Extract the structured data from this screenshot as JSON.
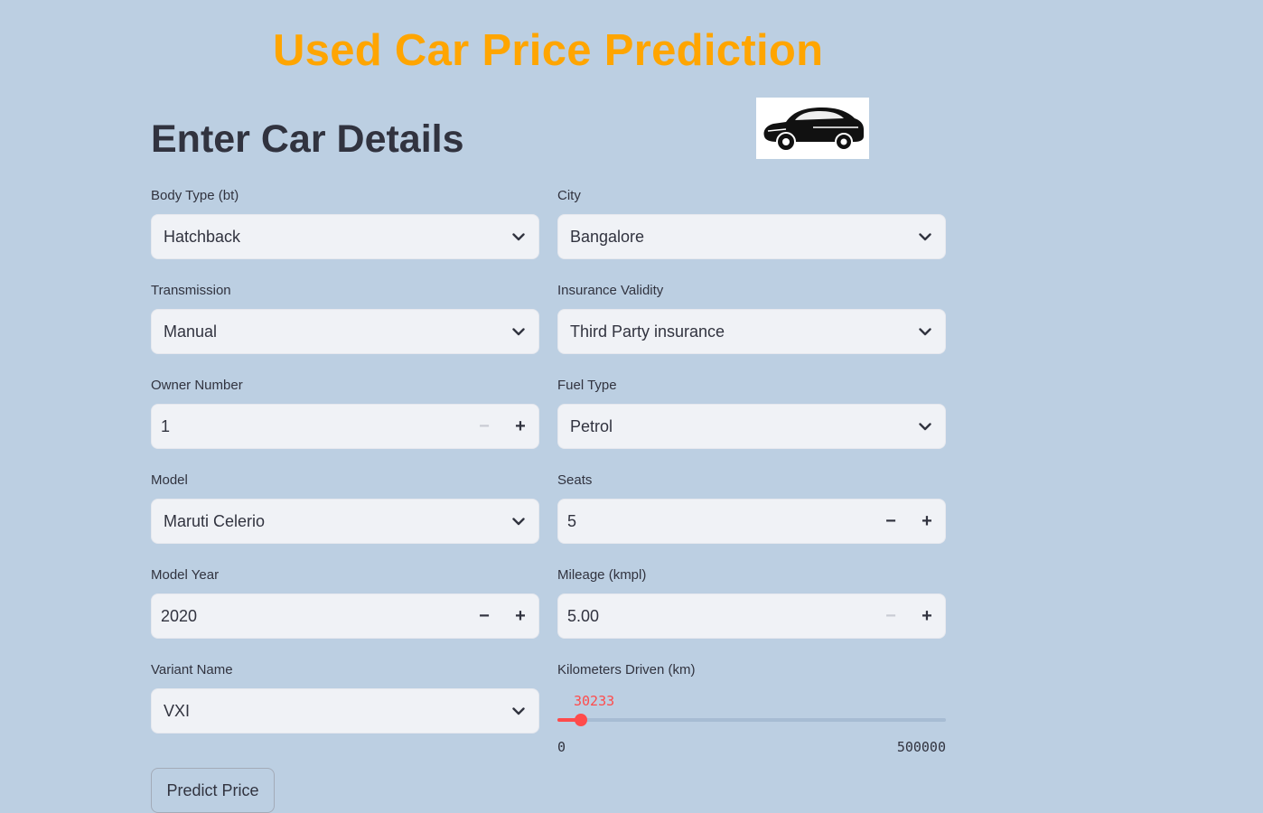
{
  "app": {
    "title": "Used Car Price Prediction"
  },
  "section": {
    "title": "Enter Car Details"
  },
  "logo": {
    "icon": "car-icon"
  },
  "form": {
    "body_type": {
      "label": "Body Type (bt)",
      "value": "Hatchback"
    },
    "city": {
      "label": "City",
      "value": "Bangalore"
    },
    "transmission": {
      "label": "Transmission",
      "value": "Manual"
    },
    "insurance": {
      "label": "Insurance Validity",
      "value": "Third Party insurance"
    },
    "owner_number": {
      "label": "Owner Number",
      "value": "1"
    },
    "fuel_type": {
      "label": "Fuel Type",
      "value": "Petrol"
    },
    "model": {
      "label": "Model",
      "value": "Maruti Celerio"
    },
    "seats": {
      "label": "Seats",
      "value": "5"
    },
    "model_year": {
      "label": "Model Year",
      "value": "2020"
    },
    "mileage": {
      "label": "Mileage (kmpl)",
      "value": "5.00"
    },
    "variant": {
      "label": "Variant Name",
      "value": "VXI"
    },
    "km_driven": {
      "label": "Kilometers Driven (km)",
      "value": "30233",
      "min": "0",
      "max": "500000"
    }
  },
  "controls": {
    "minus": "−",
    "plus": "+"
  },
  "actions": {
    "predict_label": "Predict Price"
  },
  "colors": {
    "accent": "#ff4b4b",
    "title": "#ffa500",
    "background": "#bccfe2",
    "input_bg": "#f0f2f6"
  }
}
